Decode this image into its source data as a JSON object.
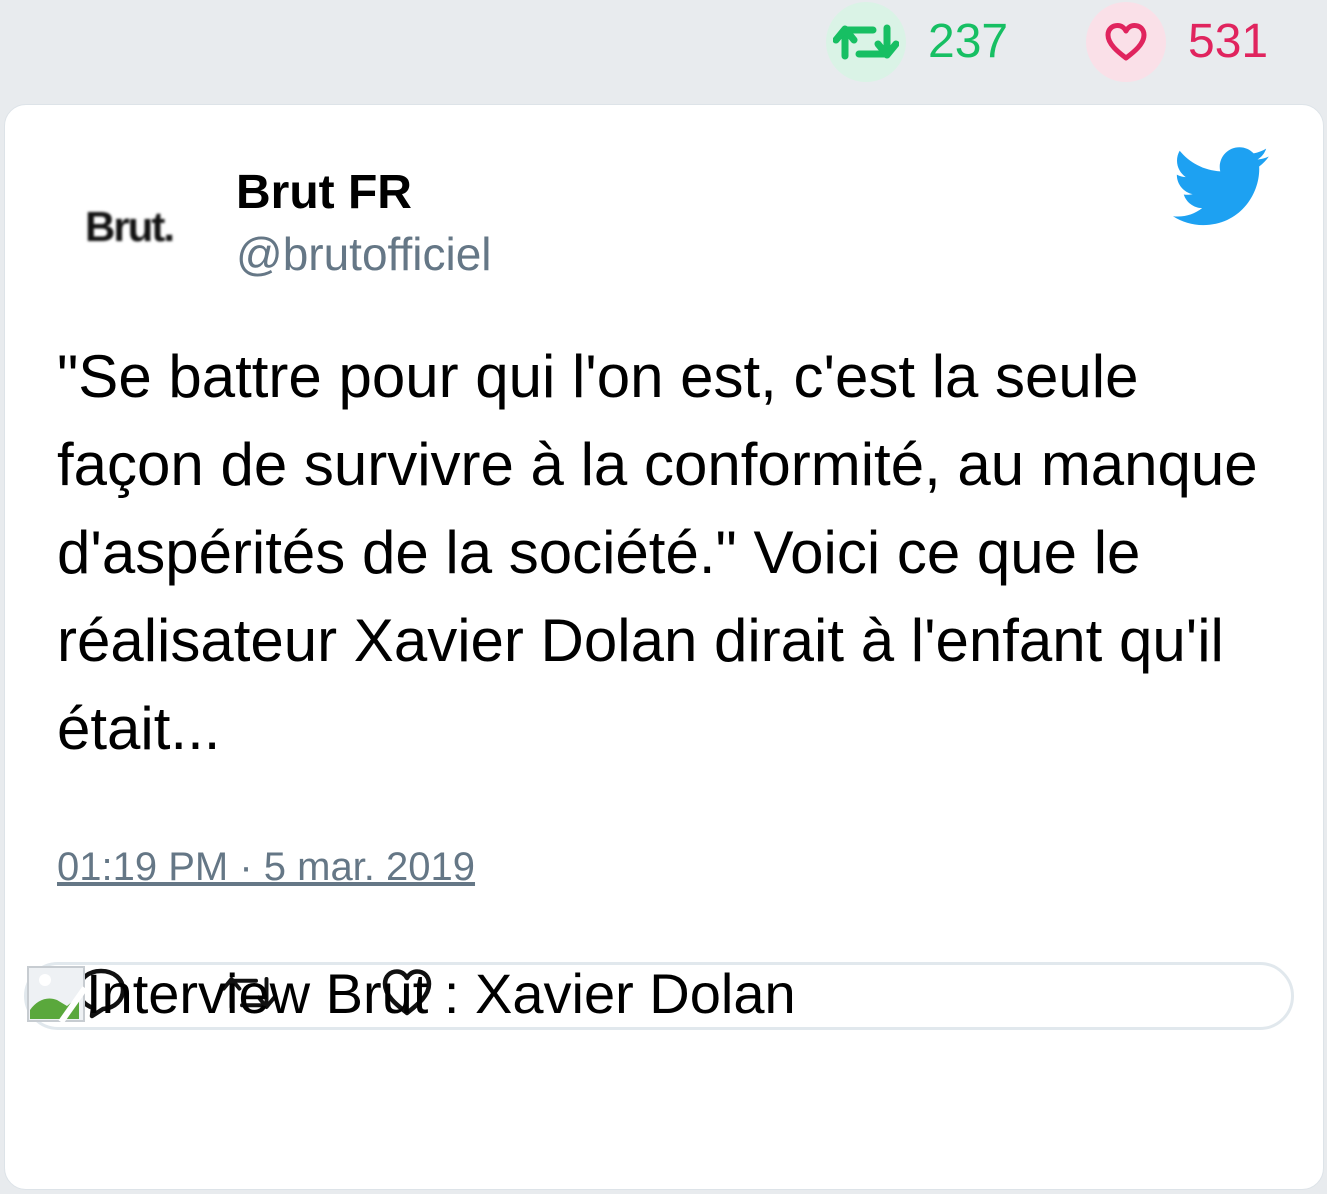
{
  "stats": {
    "retweet_count": "237",
    "like_count": "531",
    "retweet_icon": "retweet-icon",
    "like_icon": "heart-icon",
    "retweet_color": "#17bf63",
    "like_color": "#e0245e"
  },
  "author": {
    "avatar_text": "Brut.",
    "name": "Brut FR",
    "handle": "@brutofficiel"
  },
  "brand": {
    "logo_icon": "twitter-bird-icon",
    "color": "#1da1f2"
  },
  "tweet": {
    "text": "\"Se battre pour qui l'on est, c'est la seule façon de survivre à la conformité, au manque d'aspérités de la société.\" Voici ce que le réalisateur Xavier Dolan dirait à l'enfant qu'il était...",
    "timestamp": "01:19 PM · 5 mar. 2019"
  },
  "actions": [
    {
      "name": "reply",
      "icon": "reply-icon"
    },
    {
      "name": "retweet",
      "icon": "retweet-icon"
    },
    {
      "name": "like",
      "icon": "heart-icon"
    }
  ],
  "embed": {
    "alt_text": "Interview Brut : Xavier Dolan",
    "icon": "broken-image-icon"
  }
}
